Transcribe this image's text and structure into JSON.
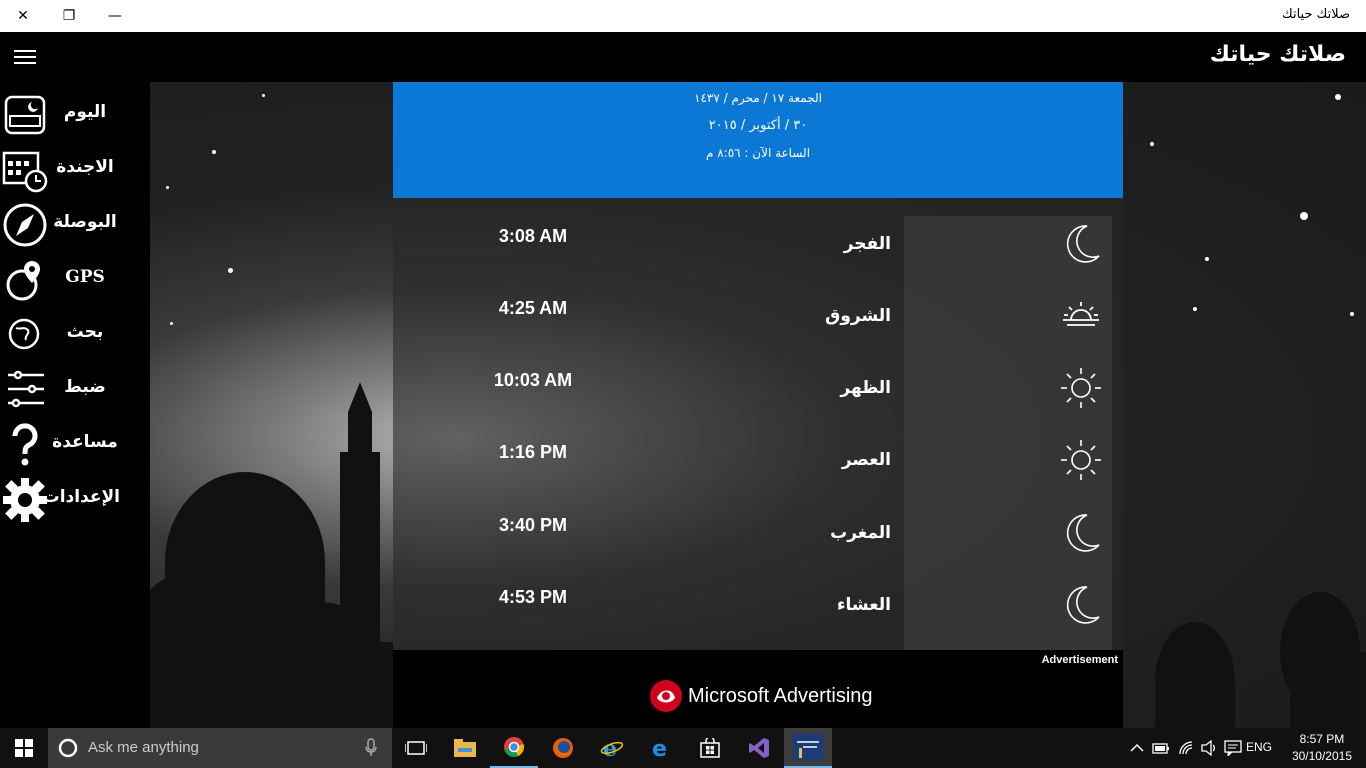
{
  "window": {
    "title": "صلاتك حياتك",
    "close": "✕",
    "restore": "❐",
    "minimize": "—"
  },
  "app": {
    "name": "صلاتك حياتك"
  },
  "sidebar": {
    "items": [
      {
        "label": "اليوم",
        "icon": "today-icon"
      },
      {
        "label": "الاجندة",
        "icon": "calendar-clock-icon"
      },
      {
        "label": "البوصلة",
        "icon": "compass-icon"
      },
      {
        "label": "GPS",
        "icon": "gps-globe-icon"
      },
      {
        "label": "بحث",
        "icon": "search-globe-icon"
      },
      {
        "label": "ضبط",
        "icon": "sliders-icon"
      },
      {
        "label": "مساعدة",
        "icon": "question-icon"
      },
      {
        "label": "الإعدادات",
        "icon": "gear-icon"
      }
    ]
  },
  "date": {
    "hijri": "الجمعة    ١٧  /  محرم  /  ١٤٣٧",
    "gregorian": "٣٠ / أكتوبر / ٢٠١٥",
    "now": "الساعة الآن  :  ٨:٥٦  م"
  },
  "prayers": [
    {
      "name": "الفجر",
      "time": "3:08  AM",
      "icon": "crescent-moon-icon"
    },
    {
      "name": "الشروق",
      "time": "4:25  AM",
      "icon": "sunrise-icon"
    },
    {
      "name": "الظهر",
      "time": "10:03  AM",
      "icon": "sun-icon"
    },
    {
      "name": "العصر",
      "time": "1:16  PM",
      "icon": "sun-icon"
    },
    {
      "name": "المغرب",
      "time": "3:40  PM",
      "icon": "crescent-moon-icon"
    },
    {
      "name": "العشاء",
      "time": "4:53  PM",
      "icon": "crescent-moon-icon"
    }
  ],
  "ad": {
    "label": "Advertisement",
    "brand": "Microsoft Advertising"
  },
  "taskbar": {
    "search_placeholder": "Ask me anything",
    "apps": [
      "task-view-icon",
      "file-explorer-icon",
      "chrome-icon",
      "firefox-icon",
      "internet-explorer-icon",
      "edge-icon",
      "store-icon",
      "visual-studio-icon",
      "salatak-app-icon"
    ],
    "language": "ENG",
    "time": "8:57 PM",
    "date": "30/10/2015"
  },
  "colors": {
    "accent": "#0a78d4",
    "background": "#000000"
  }
}
